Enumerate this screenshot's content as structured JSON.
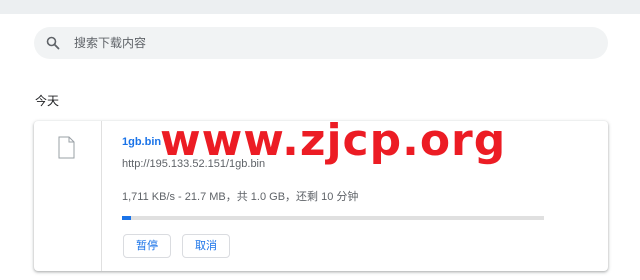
{
  "search": {
    "placeholder": "搜索下载内容",
    "icon": "search-icon"
  },
  "date_heading": "今天",
  "download": {
    "file_name": "1gb.bin",
    "url": "http://195.133.52.151/1gb.bin",
    "status": "1,711 KB/s - 21.7 MB，共 1.0 GB，还剩 10 分钟",
    "progress_fraction": 0.021,
    "icon": "file-icon",
    "pause_label": "暂停",
    "cancel_label": "取消"
  },
  "watermark": "www.zjcp.org",
  "colors": {
    "accent": "#1a73e8",
    "watermark": "#ec1c24",
    "search_bg": "#f1f3f4"
  }
}
